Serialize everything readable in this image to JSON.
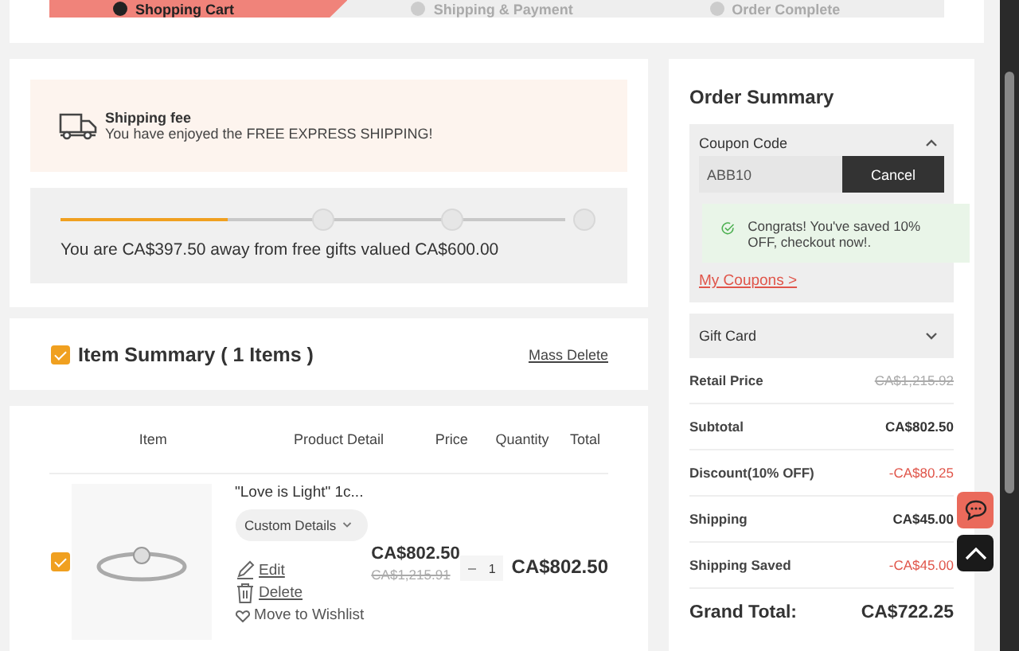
{
  "steps": [
    {
      "label": "Shopping Cart",
      "selected": true
    },
    {
      "label": "Shipping & Payment",
      "selected": false
    },
    {
      "label": "Order Complete",
      "selected": false
    }
  ],
  "shipping_notice": {
    "title": "Shipping fee",
    "message": "You have enjoyed the FREE EXPRESS SHIPPING!"
  },
  "gift_progress": {
    "level": 0.33,
    "message": "You are CA$397.50 away from free gifts valued CA$600.00"
  },
  "item_summary": {
    "title": "Item Summary ( 1 Items )",
    "checked": true,
    "action": "Mass Delete"
  },
  "table": {
    "columns": [
      "Item",
      "Product Detail",
      "Price",
      "Quantity",
      "Total"
    ],
    "rows": [
      {
        "checked": true,
        "name": "\"Love is Light\" 1c...",
        "details_button": "Custom Details",
        "actions": [
          "Edit",
          "Delete",
          "Move to Wishlist"
        ],
        "price": "CA$802.50",
        "original_price": "CA$1,215.91",
        "quantity": "1",
        "total": "CA$802.50"
      }
    ]
  },
  "order_summary": {
    "title": "Order Summary",
    "coupon": {
      "label": "Coupon Code",
      "expanded": true,
      "value": "ABB10",
      "button": "Cancel",
      "success": "Congrats! You've saved 10% OFF, checkout now!.",
      "link": "My Coupons >"
    },
    "gift_card": {
      "label": "Gift Card",
      "expanded": false
    },
    "lines": [
      {
        "label": "Retail Price",
        "value": "CA$1,215.92",
        "kind": "struck"
      },
      {
        "label": "Subtotal",
        "value": "CA$802.50",
        "kind": "plain"
      },
      {
        "label": "Discount(10% OFF)",
        "value": "-CA$80.25",
        "kind": "saving"
      },
      {
        "label": "Shipping",
        "value": "CA$45.00",
        "kind": "plain"
      },
      {
        "label": "Shipping Saved",
        "value": "-CA$45.00",
        "kind": "saving"
      }
    ],
    "grand_total": {
      "label": "Grand Total:",
      "value": "CA$722.25"
    }
  }
}
